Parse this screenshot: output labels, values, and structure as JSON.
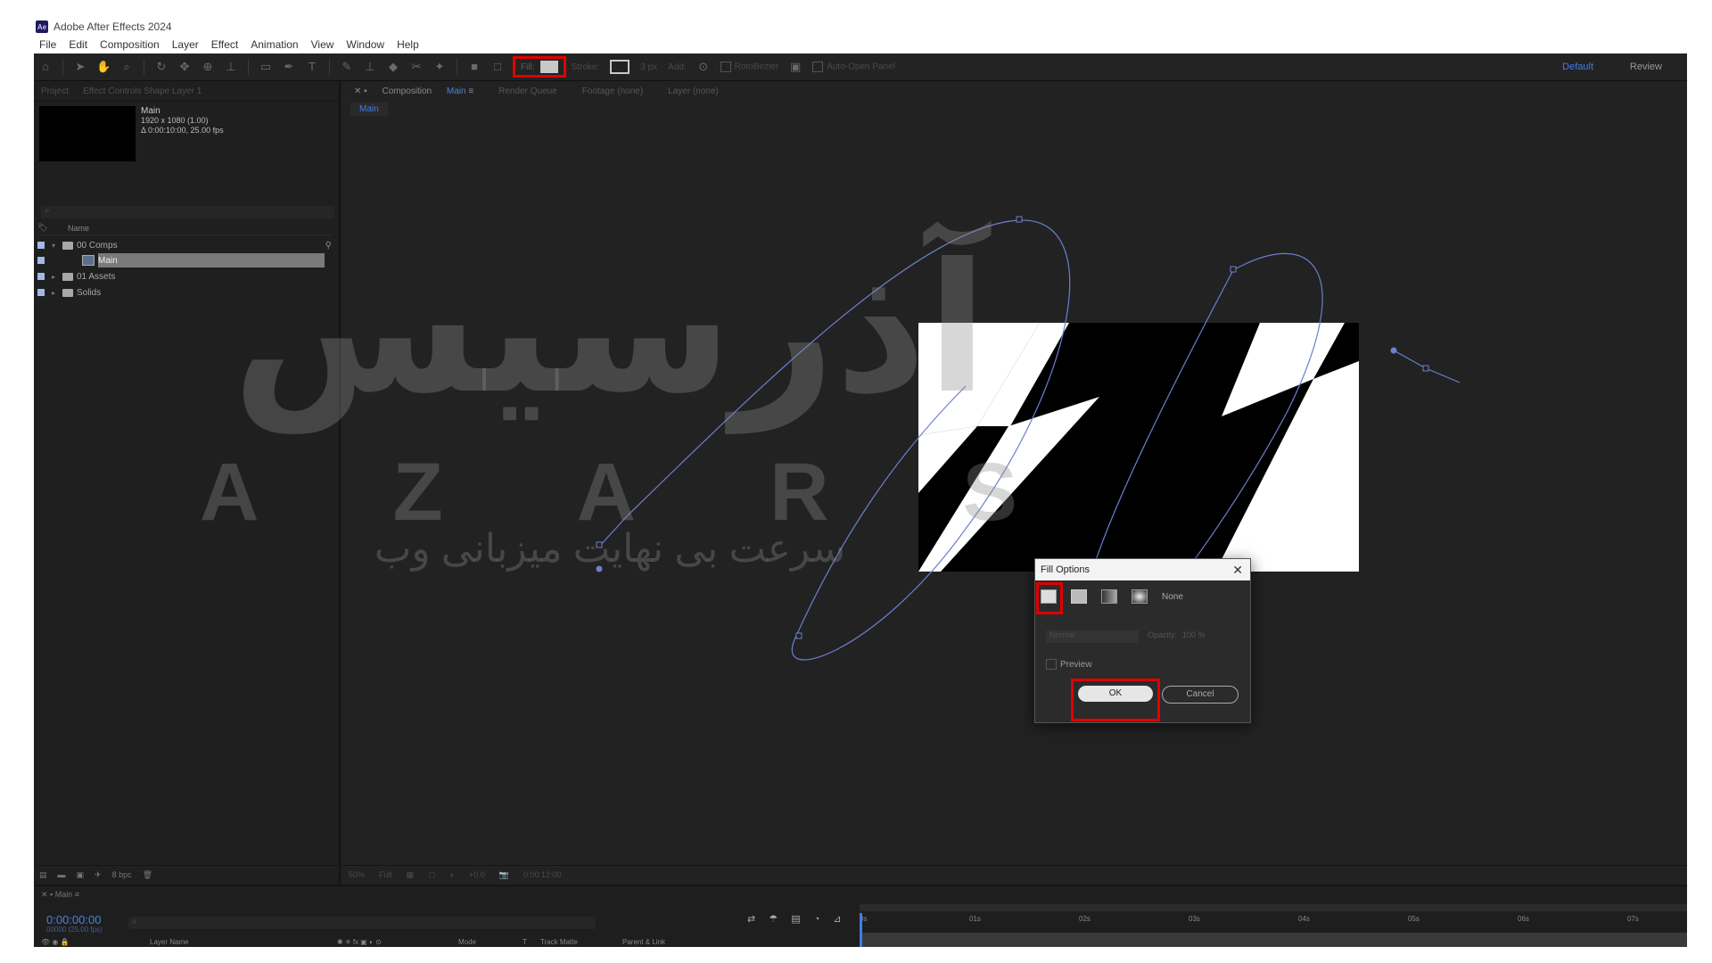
{
  "app": {
    "title": "Adobe After Effects 2024",
    "logo_text": "Ae"
  },
  "menu": [
    "File",
    "Edit",
    "Composition",
    "Layer",
    "Effect",
    "Animation",
    "View",
    "Window",
    "Help"
  ],
  "toolbar": {
    "fill_label": "Fill:",
    "stroke_label": "Stroke:",
    "stroke_width": "3 px",
    "add_label": "Add:",
    "rotobezier_label": "RotoBezier",
    "auto_open_label": "Auto-Open Panel",
    "workspace_default": "Default",
    "workspace_review": "Review"
  },
  "project_panel": {
    "tab_project": "Project",
    "tab_effect_controls": "Effect Controls Shape Layer 1",
    "comp_name": "Main",
    "comp_size": "1920 x 1080 (1.00)",
    "comp_duration": "Δ 0:00:10:00, 25.00 fps",
    "column_name": "Name",
    "items": [
      {
        "label": "00 Comps",
        "type": "folder",
        "expanded": true
      },
      {
        "label": "Main",
        "type": "comp",
        "selected": true
      },
      {
        "label": "01 Assets",
        "type": "folder"
      },
      {
        "label": "Solids",
        "type": "folder"
      }
    ],
    "bpc": "8 bpc"
  },
  "comp_panel": {
    "tab_prefix": "Composition",
    "tab_comp": "Main",
    "tab_render": "Render Queue",
    "tab_footage": "Footage (none)",
    "tab_layer": "Layer (none)",
    "sub_tab": "Main",
    "footer_zoom": "50%",
    "footer_res": "Full",
    "footer_exposure": "+0.0",
    "footer_time": "0:00:12:00"
  },
  "watermark": {
    "big": "آذرسیس",
    "latin": "AZARS",
    "persian": "سرعت بی نهایت میزبانی وب"
  },
  "fill_dialog": {
    "title": "Fill Options",
    "none_label": "None",
    "mode_value": "Normal",
    "opacity_label": "Opacity:",
    "opacity_value": "100 %",
    "preview_label": "Preview",
    "ok_label": "OK",
    "cancel_label": "Cancel"
  },
  "timeline": {
    "tab": "Main",
    "timecode": "0:00:00:00",
    "timecode_sub": "00000 (25.00 fps)",
    "col_layer_name": "Layer Name",
    "col_mode": "Mode",
    "col_t": "T",
    "col_track_matte": "Track Matte",
    "col_parent": "Parent & Link",
    "ruler_ticks": [
      "0s",
      "01s",
      "02s",
      "03s",
      "04s",
      "05s",
      "06s",
      "07s"
    ]
  },
  "colors": {
    "accent": "#3d7ee8",
    "highlight": "#e00000",
    "bg": "#1f1f1f"
  }
}
